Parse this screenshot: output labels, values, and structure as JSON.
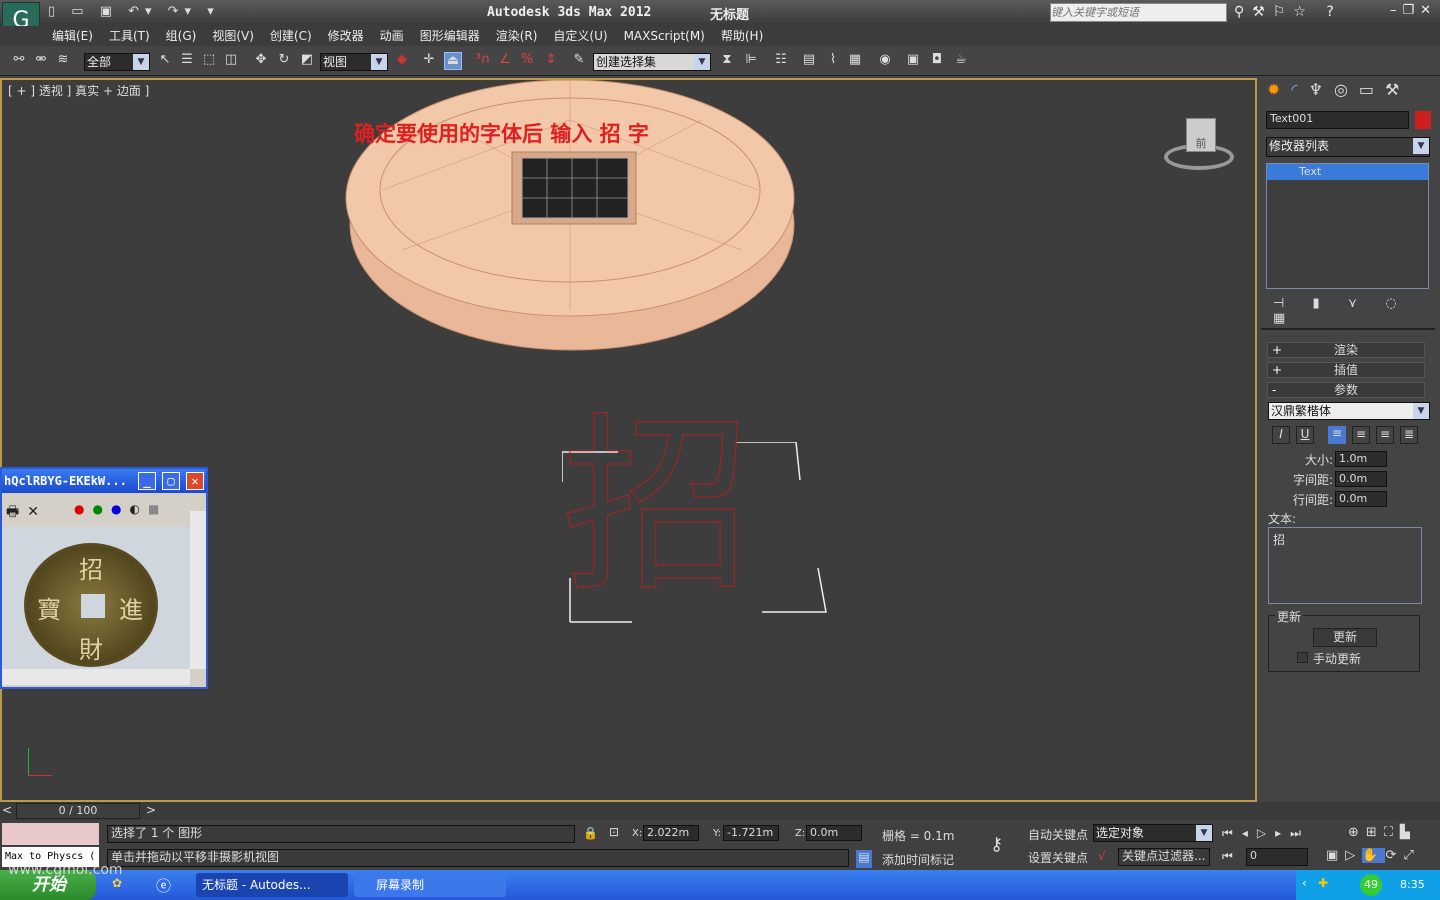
{
  "title": {
    "app": "Autodesk 3ds Max  2012",
    "doc": "无标题",
    "search_placeholder": "键入关键字或短语"
  },
  "menu": [
    "编辑(E)",
    "工具(T)",
    "组(G)",
    "视图(V)",
    "创建(C)",
    "修改器",
    "动画",
    "图形编辑器",
    "渲染(R)",
    "自定义(U)",
    "MAXScript(M)",
    "帮助(H)"
  ],
  "toolbar": {
    "filter": "全部",
    "ref_coord": "视图",
    "selection_set": "创建选择集"
  },
  "viewport": {
    "label": "[ + ] 透视 ] 真实 + 边面 ]",
    "annotation": "确定要使用的字体后 输入 招 字",
    "glyph": "招",
    "viewcube": "前"
  },
  "panel": {
    "object_name": "Text001",
    "object_color": "#cc2020",
    "modifier_list": "修改器列表",
    "stack": [
      "Text"
    ],
    "rollouts": {
      "render": "渲染",
      "interp": "插值",
      "params": "参数"
    },
    "font": "汉鼎繁楷体",
    "size_label": "大小:",
    "size": "1.0m",
    "kerning_label": "字间距:",
    "kerning": "0.0m",
    "leading_label": "行间距:",
    "leading": "0.0m",
    "text_label": "文本:",
    "text": "招",
    "update_group": "更新",
    "update_button": "更新",
    "manual_update": "手动更新"
  },
  "floatwin": {
    "title": "hQclRBYG-EKEkW...",
    "coin_chars": [
      "招",
      "進",
      "財",
      "寶"
    ]
  },
  "timeline": {
    "frame": "0 / 100"
  },
  "status": {
    "maxscript": "Max to Physcs (",
    "selected": "选择了 1 个 图形",
    "prompt": "单击并拖动以平移非摄影机视图",
    "x_label": "X:",
    "x": "2.022m",
    "y_label": "Y:",
    "y": "-1.721m",
    "z_label": "Z:",
    "z": "0.0m",
    "grid": "栅格 = 0.1m",
    "add_tag": "添加时间标记",
    "auto_key": "自动关键点",
    "set_key": "设置关键点",
    "key_mode": "选定对象",
    "key_filters": "关键点过滤器...",
    "frame_field": "0"
  },
  "taskbar": {
    "start": "开始",
    "tasks": [
      "无标题 - Autodes...",
      "屏幕录制"
    ],
    "tray_badge": "49",
    "clock": "8:35",
    "watermark": "www.cgmol.com"
  }
}
